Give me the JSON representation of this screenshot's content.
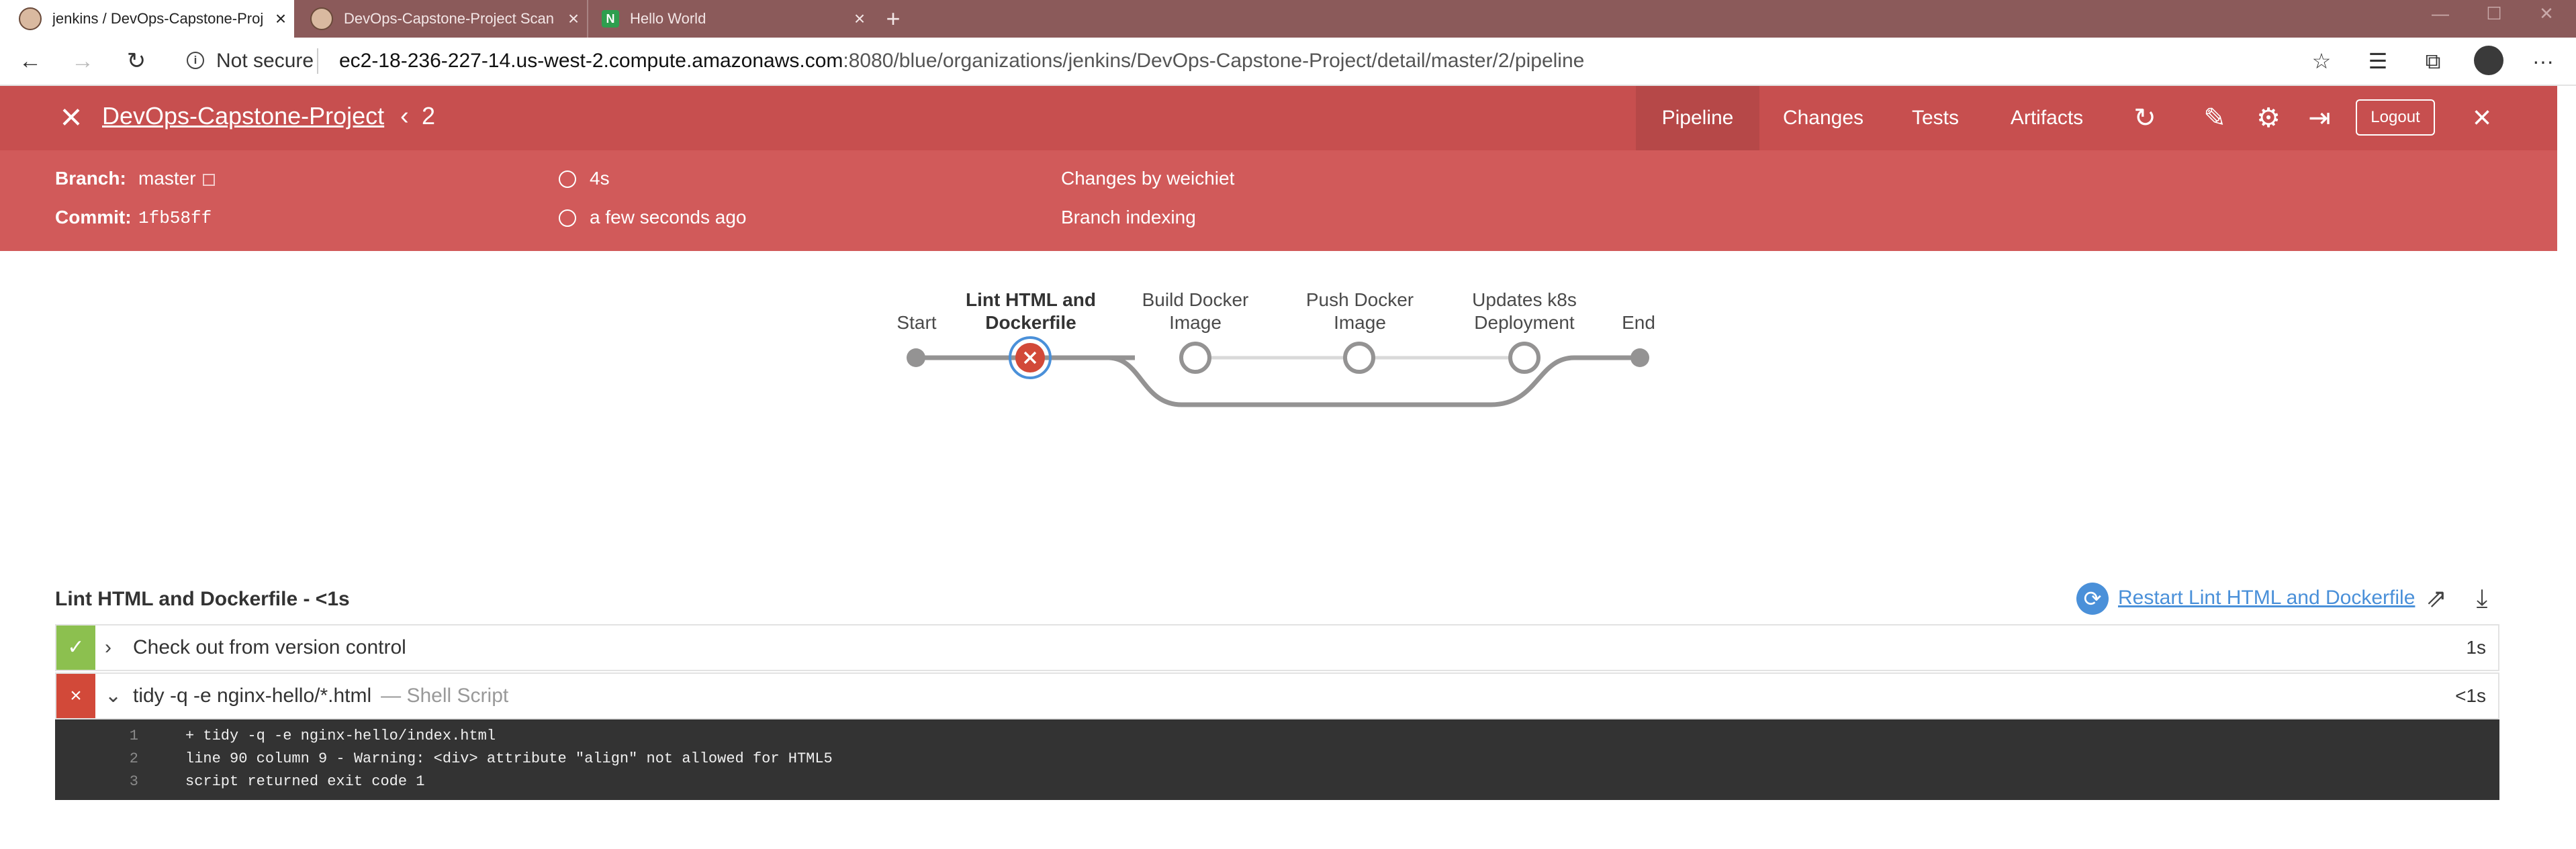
{
  "browser": {
    "tabs": [
      {
        "title": "jenkins / DevOps-Capstone-Proj",
        "active": true
      },
      {
        "title": "DevOps-Capstone-Project Scan",
        "active": false
      },
      {
        "title": "Hello World",
        "active": false
      }
    ],
    "new_tab": "+",
    "window_controls": {
      "minimize": "—",
      "maximize": "☐",
      "close": "✕"
    },
    "security_label": "Not secure",
    "url_host": "ec2-18-236-227-14.us-west-2.compute.amazonaws.com",
    "url_rest": ":8080/blue/organizations/jenkins/DevOps-Capstone-Project/detail/master/2/pipeline",
    "icons": {
      "back": "←",
      "forward": "→",
      "refresh": "↻",
      "favorite": "☆",
      "favorites_list": "☰",
      "collections": "⧉",
      "more": "···"
    }
  },
  "jenkins": {
    "project_name": "DevOps-Capstone-Project",
    "run_number": "2",
    "nav_tabs": [
      "Pipeline",
      "Changes",
      "Tests",
      "Artifacts"
    ],
    "logout_label": "Logout",
    "branch_label": "Branch:",
    "branch_value": "master",
    "commit_label": "Commit:",
    "commit_value": "1fb58ff",
    "duration": "4s",
    "started": "a few seconds ago",
    "changes": "Changes by weichiet",
    "cause": "Branch indexing",
    "header_color": "#d15a5a"
  },
  "pipeline": {
    "stages": [
      {
        "name": "Start",
        "status": "start"
      },
      {
        "name": "Lint HTML and Dockerfile",
        "status": "failed",
        "selected": true
      },
      {
        "name": "Build Docker Image",
        "status": "not_built"
      },
      {
        "name": "Push Docker Image",
        "status": "not_built"
      },
      {
        "name": "Updates k8s Deployment",
        "status": "not_built"
      },
      {
        "name": "End",
        "status": "end"
      }
    ]
  },
  "stage_detail": {
    "title": "Lint HTML and Dockerfile - <1s",
    "restart_label": "Restart Lint HTML and Dockerfile",
    "steps": [
      {
        "status": "success",
        "text": "Check out from version control",
        "subtext": "",
        "duration": "1s",
        "expanded": false
      },
      {
        "status": "failed",
        "text": "tidy -q -e nginx-hello/*.html",
        "subtext": "— Shell Script",
        "duration": "<1s",
        "expanded": true
      }
    ],
    "log": [
      {
        "n": "1",
        "text": "+ tidy -q -e nginx-hello/index.html"
      },
      {
        "n": "2",
        "text": "line 90 column 9 - Warning: <div> attribute \"align\" not allowed for HTML5"
      },
      {
        "n": "3",
        "text": "script returned exit code 1"
      }
    ]
  }
}
